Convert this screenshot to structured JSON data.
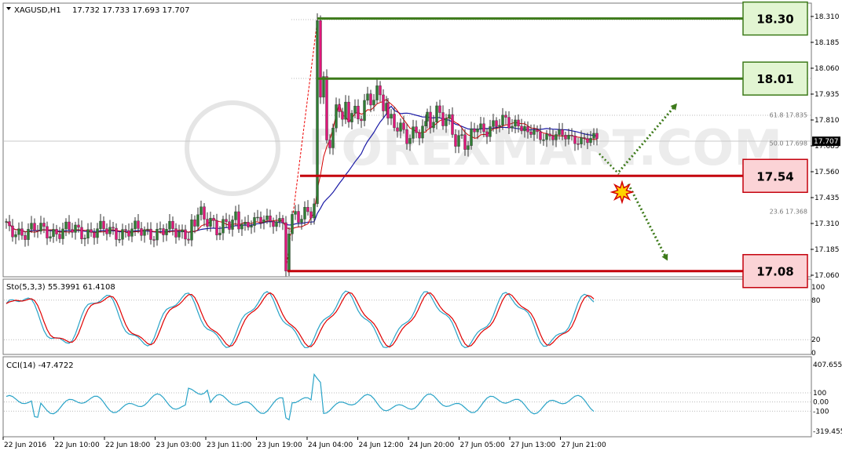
{
  "header": {
    "symbol": "XAGUSD,H1",
    "ohlc": "17.732 17.733 17.693 17.707"
  },
  "watermark": "FOREXMART.COM",
  "price_axis": {
    "ticks": [
      "18.310",
      "18.185",
      "18.060",
      "17.935",
      "17.810",
      "17.685",
      "17.560",
      "17.435",
      "17.310",
      "17.185",
      "17.060"
    ],
    "current": "17.707"
  },
  "fib_labels": [
    {
      "text": "61.8 17.835",
      "value": 17.835
    },
    {
      "text": "50.0 17.698",
      "value": 17.698
    },
    {
      "text": "23.6 17.368",
      "value": 17.368
    }
  ],
  "levels": [
    {
      "label": "18.30",
      "value": 18.3,
      "kind": "resistance",
      "color": "#3d7a1a",
      "fill": "#e2f5d2"
    },
    {
      "label": "18.01",
      "value": 18.01,
      "kind": "resistance",
      "color": "#3d7a1a",
      "fill": "#e2f5d2"
    },
    {
      "label": "17.54",
      "value": 17.54,
      "kind": "support",
      "color": "#c4000c",
      "fill": "#fbd3d6"
    },
    {
      "label": "17.08",
      "value": 17.08,
      "kind": "support",
      "color": "#c4000c",
      "fill": "#fbd3d6"
    }
  ],
  "stoch": {
    "label": "Sto(5,3,3) 55.3991 61.4108",
    "ticks": [
      "100",
      "80",
      "20",
      "0"
    ]
  },
  "cci": {
    "label": "CCI(14) -47.4722",
    "ticks": [
      "407.6554",
      "100",
      "0.00",
      "-100",
      "-319.4551"
    ]
  },
  "time_axis": [
    "22 Jun 2016",
    "22 Jun 10:00",
    "22 Jun 18:00",
    "23 Jun 03:00",
    "23 Jun 11:00",
    "23 Jun 19:00",
    "24 Jun 04:00",
    "24 Jun 12:00",
    "24 Jun 20:00",
    "27 Jun 05:00",
    "27 Jun 13:00",
    "27 Jun 21:00"
  ],
  "colors": {
    "bull_candle": "#2e7d32",
    "bear_candle": "#e0157a",
    "ma_fast": "#d40000",
    "ma_slow": "#1a1aa6",
    "stoch_main": "#29a3c7",
    "stoch_signal": "#e00000",
    "cci": "#29a3c7",
    "arrow": "#3d7a1a"
  },
  "chart_data": {
    "type": "candlestick",
    "title": "XAGUSD,H1",
    "ylim": [
      17.03,
      18.36
    ],
    "current_price": 17.707,
    "scenario_arrows": [
      {
        "direction": "up",
        "from": 17.56,
        "to": 17.89
      },
      {
        "direction": "down",
        "from": 17.5,
        "to": 17.13
      }
    ]
  }
}
